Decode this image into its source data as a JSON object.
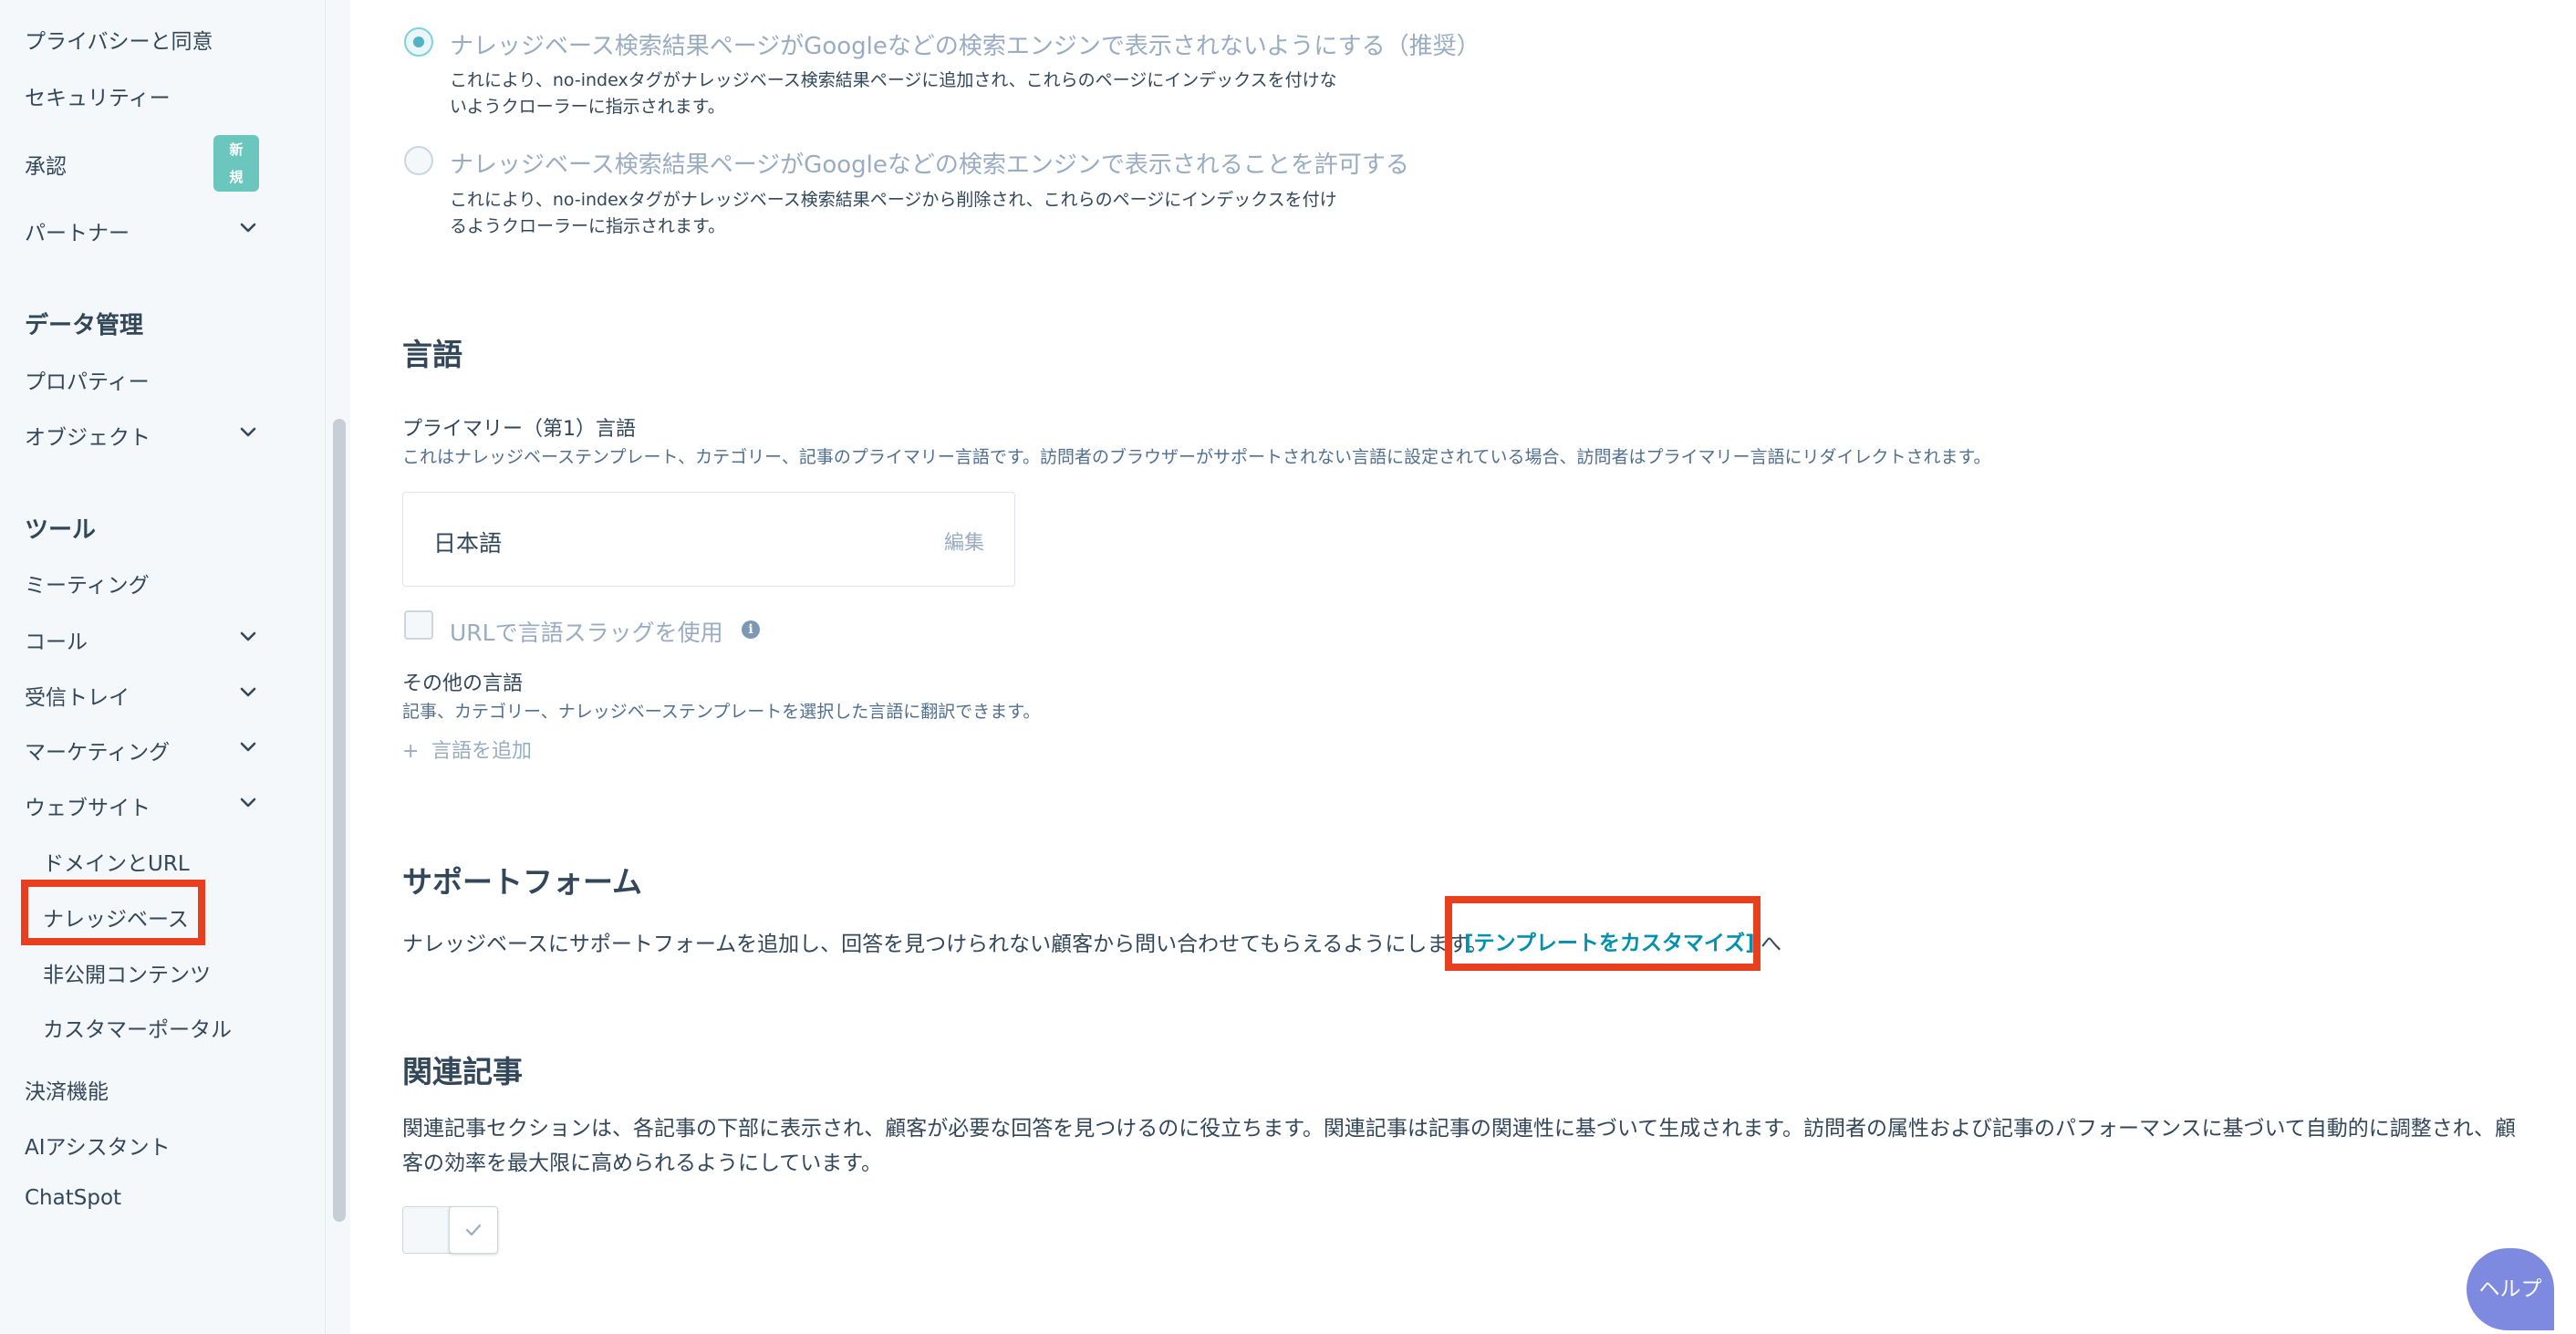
{
  "sidebar": {
    "items": [
      {
        "label": "プライバシーと同意"
      },
      {
        "label": "セキュリティー"
      },
      {
        "label": "承認",
        "badge": "新規"
      },
      {
        "label": "パートナー"
      },
      {
        "label": "プロパティー"
      },
      {
        "label": "オブジェクト"
      },
      {
        "label": "ミーティング"
      },
      {
        "label": "コール"
      },
      {
        "label": "受信トレイ"
      },
      {
        "label": "マーケティング"
      },
      {
        "label": "ウェブサイト"
      },
      {
        "label": "ドメインとURL"
      },
      {
        "label": "ナレッジベース",
        "selected": true
      },
      {
        "label": "非公開コンテンツ"
      },
      {
        "label": "カスタマーポータル"
      },
      {
        "label": "決済機能"
      },
      {
        "label": "AIアシスタント"
      },
      {
        "label": "ChatSpot"
      }
    ],
    "badge_line1": "新",
    "badge_line2": "規",
    "sections": {
      "data_management": "データ管理",
      "tools": "ツール"
    }
  },
  "indexing": {
    "option_noindex": {
      "label": "ナレッジベース検索結果ページがGoogleなどの検索エンジンで表示されないようにする（推奨）",
      "desc": "これにより、no-indexタグがナレッジベース検索結果ページに追加され、これらのページにインデックスを付けないようクローラーに指示されます。",
      "selected": true
    },
    "option_index": {
      "label": "ナレッジベース検索結果ページがGoogleなどの検索エンジンで表示されることを許可する",
      "desc": "これにより、no-indexタグがナレッジベース検索結果ページから削除され、これらのページにインデックスを付けるようクローラーに指示されます。",
      "selected": false
    }
  },
  "language": {
    "heading": "言語",
    "primary_label": "プライマリー（第1）言語",
    "primary_desc": "これはナレッジベーステンプレート、カテゴリー、記事のプライマリー言語です。訪問者のブラウザーがサポートされない言語に設定されている場合、訪問者はプライマリー言語にリダイレクトされます。",
    "primary_value": "日本語",
    "edit_label": "編集",
    "slug_checkbox_label": "URLで言語スラッグを使用",
    "slug_checked": false,
    "other_label": "その他の言語",
    "other_desc": "記事、カテゴリー、ナレッジベーステンプレートを選択した言語に翻訳できます。",
    "add_language_label": "言語を追加"
  },
  "support_form": {
    "heading": "サポートフォーム",
    "text_before": "ナレッジベースにサポートフォームを追加し、回答を見つけられない顧客から問い合わせてもらえるようにします。",
    "link_text": "[テンプレートをカスタマイズ]",
    "text_after": "へ"
  },
  "related_articles": {
    "heading": "関連記事",
    "desc": "関連記事セクションは、各記事の下部に表示され、顧客が必要な回答を見つけるのに役立ちます。関連記事は記事の関連性に基づいて生成されます。訪問者の属性および記事のパフォーマンスに基づいて自動的に調整され、顧客の効率を最大限に高められるようにしています。",
    "toggle_on": true
  },
  "help_button_label": "ヘルプ",
  "colors": {
    "highlight": "#e8401f",
    "link": "#0091ae",
    "badge": "#6bc7bd",
    "help": "#7e89e0"
  },
  "icons": {
    "expand": "chevron-down-icon",
    "add": "plus-icon",
    "info": "info-icon",
    "check": "check-icon"
  }
}
